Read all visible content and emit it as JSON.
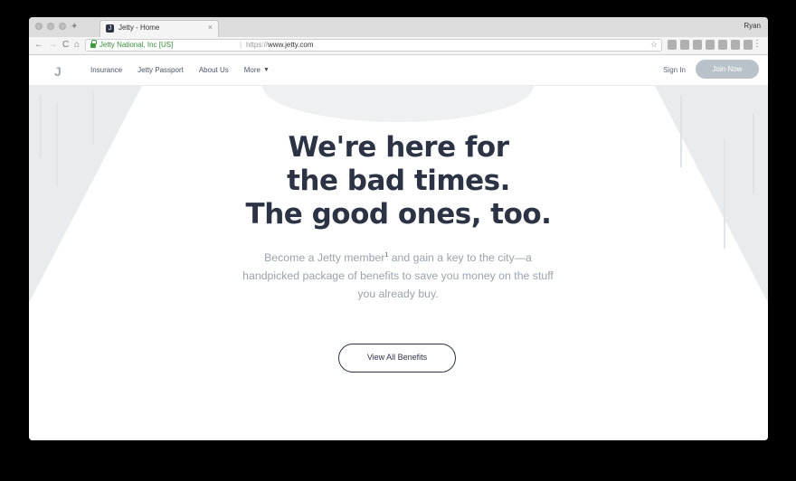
{
  "browser": {
    "tab_title": "Jetty - Home",
    "tab_close": "×",
    "profile_name": "Ryan",
    "cert_name": "Jetty National, Inc [US]",
    "url_scheme": "https://",
    "url_host": "www.jetty.com",
    "back": "←",
    "forward": "→",
    "reload": "C",
    "home": "⌂",
    "star": "☆",
    "menu": "⋮"
  },
  "site": {
    "logo": "J",
    "nav": [
      {
        "label": "Insurance"
      },
      {
        "label": "Jetty Passport"
      },
      {
        "label": "About Us"
      },
      {
        "label": "More"
      }
    ],
    "signin_label": "Sign In",
    "join_label": "Join Now"
  },
  "hero": {
    "headline": [
      "We're here for",
      "the bad times.",
      "The good ones, too."
    ],
    "subtext_before": "Become a Jetty member",
    "subtext_sup": "1",
    "subtext_after": " and gain a key to the city—a handpicked package of benefits to save you money on the stuff you already buy.",
    "cta_label": "View All Benefits"
  },
  "colors": {
    "headline": "#2b3344",
    "subtext": "#9aa3ad",
    "join_button": "#b9c2c8"
  }
}
